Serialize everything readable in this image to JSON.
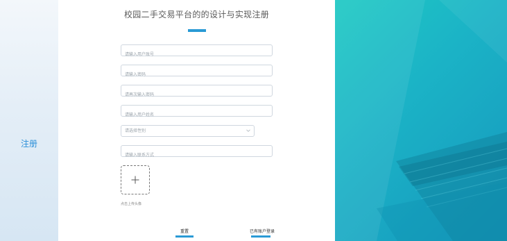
{
  "sidebar": {
    "label": "注册"
  },
  "form": {
    "title": "校园二手交易平台的的设计与实现注册",
    "fields": [
      {
        "placeholder": "请输入用户账号",
        "value": ""
      },
      {
        "placeholder": "请输入密码",
        "value": ""
      },
      {
        "placeholder": "请再次输入密码",
        "value": ""
      },
      {
        "placeholder": "请输入用户姓名",
        "value": ""
      }
    ],
    "gender_select": {
      "value": "请选择性别",
      "icon": "chevron-down-icon"
    },
    "contact_field": {
      "placeholder": "请输入联系方式",
      "value": ""
    },
    "upload": {
      "icon": "plus-icon",
      "hint": "点击上传头像"
    },
    "reset_button": "重置",
    "login_link": "已有账户登录"
  },
  "colors": {
    "accent": "#2a9ad5",
    "sidebar_text": "#2b8fd8",
    "teal_start": "#1fc9c4",
    "teal_end": "#1697be"
  }
}
